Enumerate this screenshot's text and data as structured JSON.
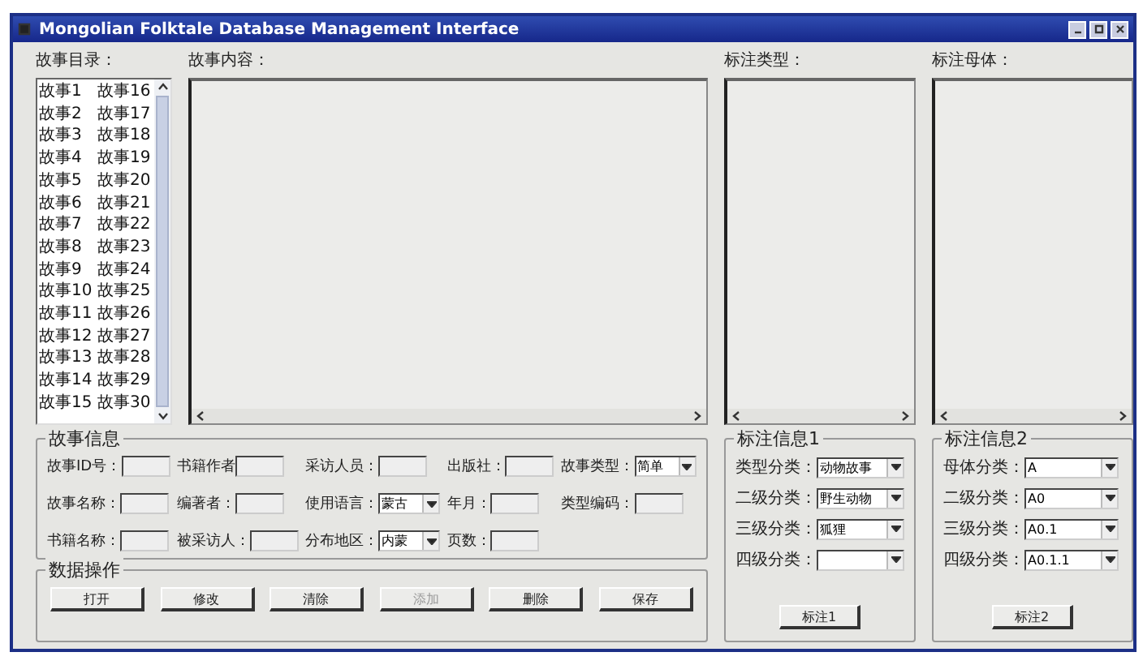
{
  "window": {
    "title": "Mongolian Folktale Database Management Interface"
  },
  "story_list": {
    "label": "故事目录：",
    "items": [
      "故事1",
      "故事2",
      "故事3",
      "故事4",
      "故事5",
      "故事6",
      "故事7",
      "故事8",
      "故事9",
      "故事10",
      "故事11",
      "故事12",
      "故事13",
      "故事14",
      "故事15",
      "故事16",
      "故事17",
      "故事18",
      "故事19",
      "故事20",
      "故事21",
      "故事22",
      "故事23",
      "故事24",
      "故事25",
      "故事26",
      "故事27",
      "故事28",
      "故事29",
      "故事30"
    ]
  },
  "story_content": {
    "label": "故事内容："
  },
  "annotation_type": {
    "label": "标注类型："
  },
  "annotation_motif": {
    "label": "标注母体："
  },
  "story_info": {
    "title": "故事信息",
    "rows": [
      [
        {
          "kind": "text",
          "label": "故事ID号："
        },
        {
          "kind": "text",
          "label": "书籍作者"
        },
        {
          "kind": "text",
          "label": "采访人员："
        },
        {
          "kind": "text",
          "label": "出版社："
        },
        {
          "kind": "select",
          "label": "故事类型：",
          "value": "简单"
        }
      ],
      [
        {
          "kind": "text",
          "label": "故事名称："
        },
        {
          "kind": "text",
          "label": "编著者："
        },
        {
          "kind": "select",
          "label": "使用语言：",
          "value": "蒙古"
        },
        {
          "kind": "text",
          "label": "年月："
        },
        {
          "kind": "text",
          "label": "类型编码："
        }
      ],
      [
        {
          "kind": "text",
          "label": "书籍名称："
        },
        {
          "kind": "text",
          "label": "被采访人："
        },
        {
          "kind": "select",
          "label": "分布地区：",
          "value": "内蒙"
        },
        {
          "kind": "text",
          "label": "页数："
        }
      ]
    ]
  },
  "data_ops": {
    "title": "数据操作",
    "buttons": [
      {
        "label": "打开",
        "disabled": false
      },
      {
        "label": "修改",
        "disabled": false
      },
      {
        "label": "清除",
        "disabled": false
      },
      {
        "label": "添加",
        "disabled": true
      },
      {
        "label": "删除",
        "disabled": false
      },
      {
        "label": "保存",
        "disabled": false
      }
    ]
  },
  "annotation_info_1": {
    "title": "标注信息1",
    "fields": [
      {
        "label": "类型分类：",
        "value": "动物故事"
      },
      {
        "label": "二级分类：",
        "value": "野生动物"
      },
      {
        "label": "三级分类：",
        "value": "狐狸"
      },
      {
        "label": "四级分类："
      }
    ],
    "button": "标注1"
  },
  "annotation_info_2": {
    "title": "标注信息2",
    "fields": [
      {
        "label": "母体分类：",
        "value": "A"
      },
      {
        "label": "二级分类：",
        "value": "A0"
      },
      {
        "label": "三级分类：",
        "value": "A0.1"
      },
      {
        "label": "四级分类：",
        "value": "A0.1.1"
      }
    ],
    "button": "标注2"
  }
}
